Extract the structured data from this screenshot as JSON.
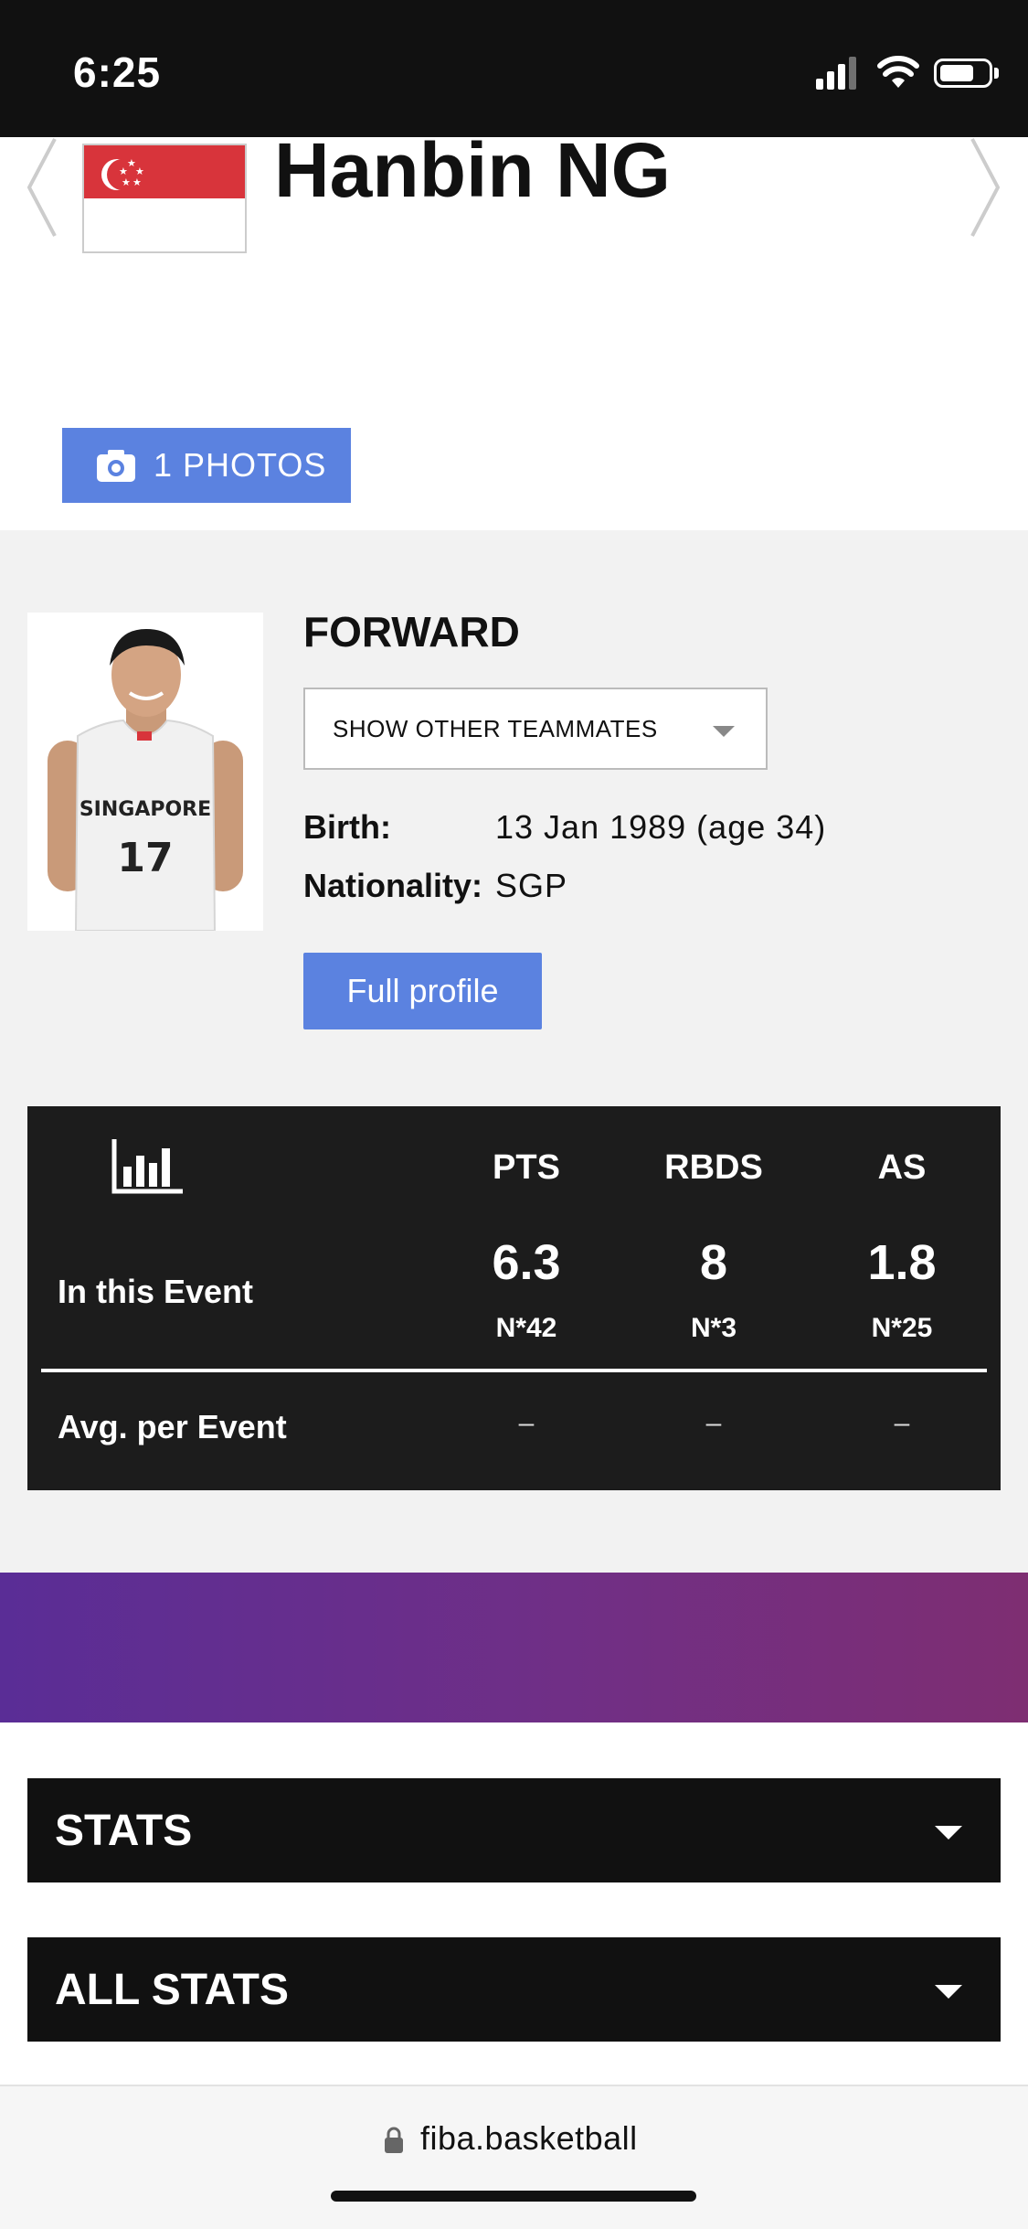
{
  "status": {
    "time": "6:25"
  },
  "header": {
    "name": "Hanbin NG",
    "flag_icon": "singapore-flag-icon"
  },
  "photos_button": {
    "label": "1 PHOTOS"
  },
  "profile": {
    "position": "FORWARD",
    "teammates_dropdown": "SHOW OTHER TEAMMATES",
    "birth_label": "Birth:",
    "birth_value": "13 Jan 1989 (age 34)",
    "nationality_label": "Nationality:",
    "nationality_value": "SGP",
    "full_profile_button": "Full profile"
  },
  "stats": {
    "columns": [
      "PTS",
      "RBDS",
      "AS"
    ],
    "rows": [
      {
        "label": "In this Event",
        "values": [
          "6.3",
          "8",
          "1.8"
        ],
        "ranks": [
          "N*42",
          "N*3",
          "N*25"
        ]
      },
      {
        "label": "Avg. per Event",
        "values": [
          "–",
          "–",
          "–"
        ]
      }
    ]
  },
  "accordions": [
    {
      "label": "STATS"
    },
    {
      "label": "ALL STATS"
    }
  ],
  "browser": {
    "url": "fiba.basketball"
  },
  "colors": {
    "accent": "#5b82e0",
    "dark": "#1c1c1c",
    "flag_red": "#d8343b"
  }
}
